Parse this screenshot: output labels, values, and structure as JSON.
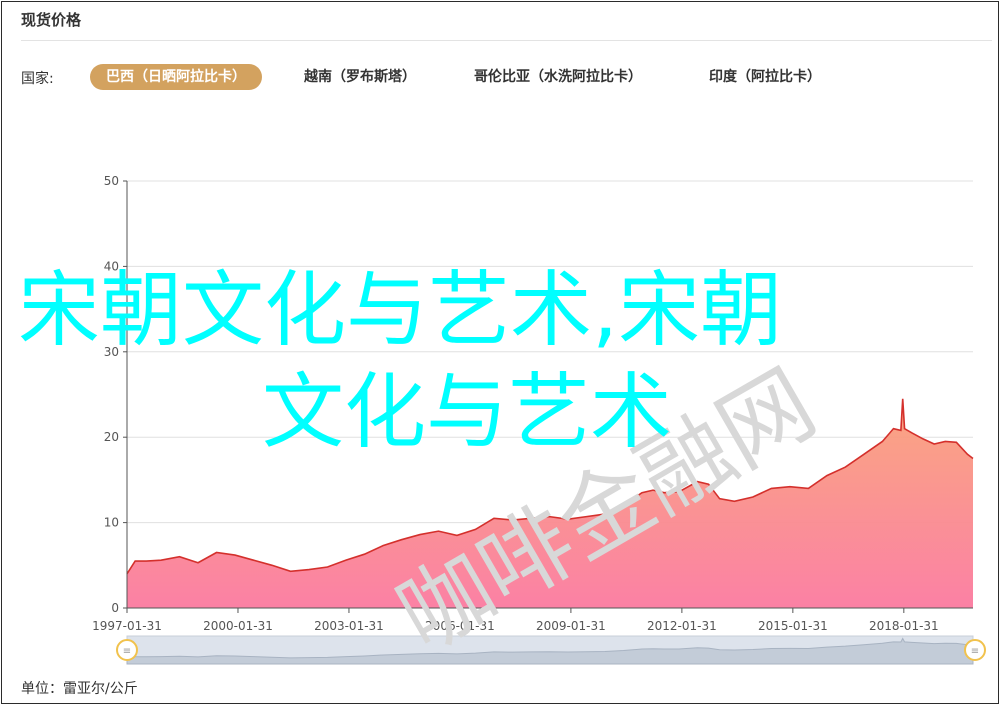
{
  "header": {
    "title": "现货价格"
  },
  "filter": {
    "label": "国家:",
    "tabs": [
      {
        "label": "巴西（日晒阿拉比卡）",
        "active": true
      },
      {
        "label": "越南（罗布斯塔）",
        "active": false
      },
      {
        "label": "哥伦比亚（水洗阿拉比卡）",
        "active": false
      },
      {
        "label": "印度（阿拉比卡）",
        "active": false
      }
    ]
  },
  "overlay": {
    "line1": "宋朝文化与艺术,宋朝",
    "line2": "文化与艺术"
  },
  "watermark": "咖啡金融网",
  "unit": "单位：雷亚尔/公斤",
  "colors": {
    "accent": "#d3a25f",
    "line": "#d4302c",
    "area_top": "#f9a27a",
    "area_bottom": "#fb7aa0",
    "overlay": "#00ffff"
  },
  "chart_data": {
    "type": "area",
    "ylim": [
      0,
      50
    ],
    "y_ticks": [
      0,
      10,
      20,
      30,
      40,
      50
    ],
    "x_tick_labels": [
      "1997-01-31",
      "2000-01-31",
      "2003-01-31",
      "2006-01-31",
      "2009-01-31",
      "2012-01-31",
      "2015-01-31",
      "2018-01-31"
    ],
    "xlim": [
      1997.08,
      2019.95
    ],
    "grid": true,
    "x": [
      1997.08,
      1997.3,
      1997.6,
      1998.0,
      1998.5,
      1999.0,
      1999.5,
      2000.0,
      2000.5,
      2001.0,
      2001.5,
      2002.0,
      2002.5,
      2003.0,
      2003.5,
      2004.0,
      2004.5,
      2005.0,
      2005.5,
      2006.0,
      2006.5,
      2007.0,
      2007.5,
      2008.0,
      2008.5,
      2009.0,
      2009.5,
      2010.0,
      2010.5,
      2011.0,
      2011.3,
      2011.6,
      2012.0,
      2012.5,
      2012.8,
      2013.1,
      2013.5,
      2014.0,
      2014.5,
      2015.0,
      2015.5,
      2016.0,
      2016.5,
      2017.0,
      2017.5,
      2017.8,
      2018.0,
      2018.05,
      2018.1,
      2018.3,
      2018.6,
      2018.9,
      2019.2,
      2019.5,
      2019.8,
      2019.95
    ],
    "values": [
      4.0,
      5.5,
      5.5,
      5.6,
      6.0,
      5.3,
      6.5,
      6.2,
      5.6,
      5.0,
      4.3,
      4.5,
      4.8,
      5.6,
      6.3,
      7.3,
      8.0,
      8.6,
      9.0,
      8.5,
      9.2,
      10.5,
      10.3,
      10.5,
      10.7,
      10.4,
      10.7,
      11.0,
      12.0,
      13.5,
      13.8,
      13.5,
      13.6,
      14.8,
      14.5,
      12.8,
      12.5,
      13.0,
      14.0,
      14.2,
      14.0,
      15.5,
      16.5,
      18.0,
      19.5,
      21.0,
      20.8,
      24.5,
      21.0,
      20.5,
      19.8,
      19.2,
      19.5,
      19.4,
      18.0,
      17.5
    ],
    "unit": "雷亚尔/公斤"
  }
}
